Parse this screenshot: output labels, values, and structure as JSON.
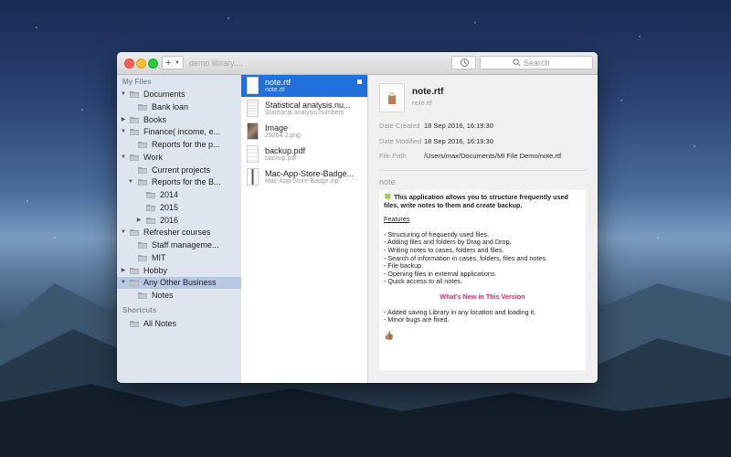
{
  "toolbar": {
    "add_label": "+",
    "library_title": "demo library....",
    "search_placeholder": "Search"
  },
  "sidebar": {
    "my_files_header": "My Files",
    "shortcuts_header": "Shortcuts",
    "items": [
      {
        "label": "Documents",
        "disclosure": "▼"
      },
      {
        "label": "Bank loan",
        "disclosure": ""
      },
      {
        "label": "Books",
        "disclosure": "▶"
      },
      {
        "label": "Finance( income, e...",
        "disclosure": "▼"
      },
      {
        "label": "Reports for the p...",
        "disclosure": ""
      },
      {
        "label": "Work",
        "disclosure": "▼"
      },
      {
        "label": "Current projects",
        "disclosure": ""
      },
      {
        "label": "Reports for the B...",
        "disclosure": "▼"
      },
      {
        "label": "2014",
        "disclosure": ""
      },
      {
        "label": "2015",
        "disclosure": ""
      },
      {
        "label": "2016",
        "disclosure": "▶"
      },
      {
        "label": "Refresher courses",
        "disclosure": "▼"
      },
      {
        "label": "Staff manageme...",
        "disclosure": ""
      },
      {
        "label": "MIT",
        "disclosure": ""
      },
      {
        "label": "Hobby",
        "disclosure": "▶"
      },
      {
        "label": "Any Other Business",
        "disclosure": "▼"
      },
      {
        "label": "Notes",
        "disclosure": ""
      }
    ],
    "shortcuts": [
      {
        "label": "All Notes"
      }
    ]
  },
  "files": [
    {
      "name": "note.rtf",
      "sub": "note.rtf"
    },
    {
      "name": "Statistical analysis.nu...",
      "sub": "Statistical analysis.numbers"
    },
    {
      "name": "Image",
      "sub": "29364 2.png"
    },
    {
      "name": "backup.pdf",
      "sub": "backup.pdf"
    },
    {
      "name": "Mac-App-Store-Badge...",
      "sub": "Mac-App-Store-Badge.zip"
    }
  ],
  "detail": {
    "title": "note.rtf",
    "subtitle": "note.rtf",
    "created_label": "Date Created",
    "created_value": "18 Sep 2016, 16:19:30",
    "modified_label": "Date Modified",
    "modified_value": "18 Sep 2016, 16:19:30",
    "path_label": "File Path",
    "path_value": "/Users/max/Documents/MI File Demo/note.rtf",
    "note_header": "note"
  },
  "note": {
    "intro_icon": "🍀",
    "intro": "This application allows you to structure frequently used files, write notes to them and create backup.",
    "features_heading": "Features",
    "features": [
      "- Structuring of frequently used files.",
      "- Adding files and folders by Drag and Drop.",
      "- Writing notes to cases, folders and files.",
      "- Search of information in cases, folders, files and notes.",
      "- File backup.",
      "- Opening files in external applications.",
      "- Quick access to all notes."
    ],
    "whats_new_heading": "What's New in This Version",
    "changes": [
      "- Added saving Library in any location and loading it.",
      "- Minor bugs are fixed."
    ],
    "closing_icon": "👍🏽"
  },
  "colors": {
    "selection_blue": "#1f6fdc",
    "sidebar_bg": "#dfe5ef",
    "sidebar_selected": "#b7c8e4",
    "whats_new_pink": "#e0286a"
  }
}
